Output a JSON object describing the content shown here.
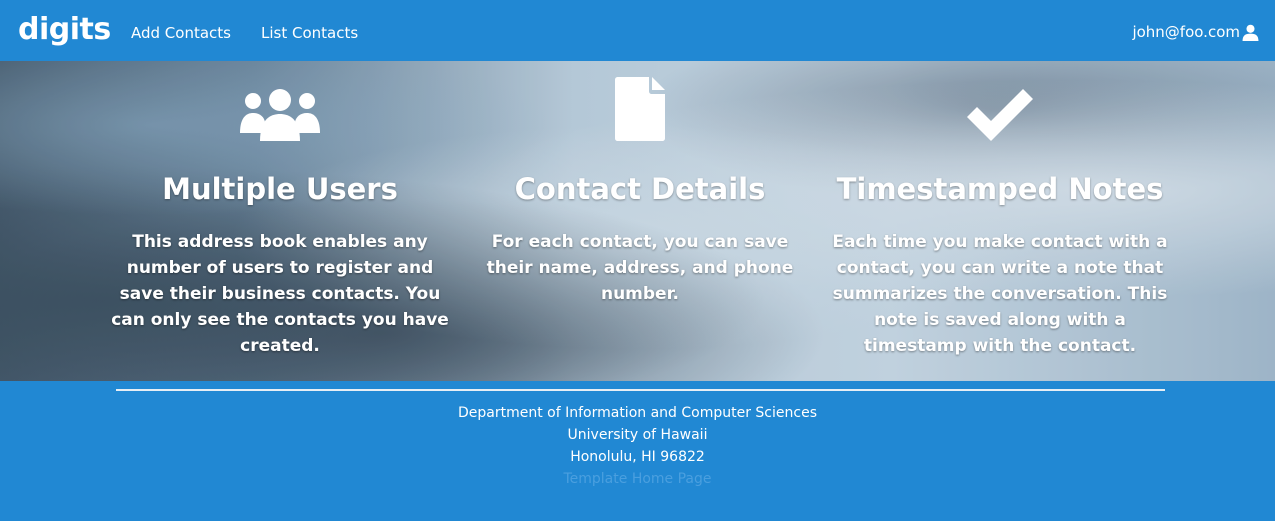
{
  "navbar": {
    "brand": "digits",
    "links": [
      "Add Contacts",
      "List Contacts"
    ],
    "user_email": "john@foo.com",
    "user_icon": "user-icon"
  },
  "features": [
    {
      "icon": "users-icon",
      "title": "Multiple Users",
      "text": "This address book enables any number of users to register and save their business contacts. You can only see the contacts you have created."
    },
    {
      "icon": "file-icon",
      "title": "Contact Details",
      "text": "For each contact, you can save their name, address, and phone number."
    },
    {
      "icon": "checkmark-icon",
      "title": "Timestamped Notes",
      "text": "Each time you make contact with a contact, you can write a note that summarizes the conversation. This note is saved along with a timestamp with the contact."
    }
  ],
  "footer": {
    "department": "Department of Information and Computer Sciences",
    "university": "University of Hawaii",
    "location": "Honolulu, HI 96822",
    "template_link": "Template Home Page"
  },
  "colors": {
    "primary": "#2188d3",
    "text": "#ffffff",
    "faint_link": "#4a9fdf"
  }
}
